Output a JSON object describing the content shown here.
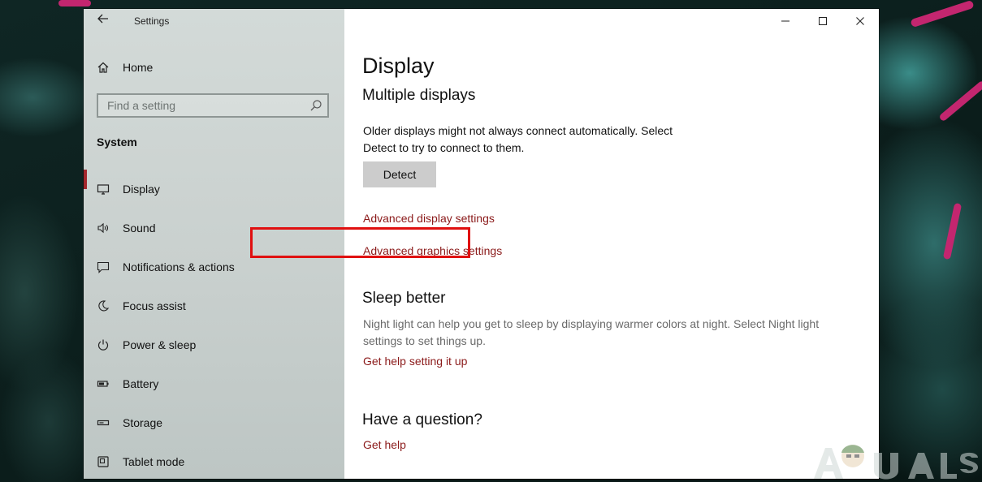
{
  "window": {
    "title": "Settings",
    "controls": [
      "minimize",
      "maximize",
      "close"
    ]
  },
  "sidebar": {
    "home_label": "Home",
    "search": {
      "placeholder": "Find a setting"
    },
    "section_label": "System",
    "items": [
      {
        "label": "Display",
        "icon": "monitor-icon",
        "selected": true
      },
      {
        "label": "Sound",
        "icon": "speaker-icon"
      },
      {
        "label": "Notifications & actions",
        "icon": "notification-icon"
      },
      {
        "label": "Focus assist",
        "icon": "moon-icon"
      },
      {
        "label": "Power & sleep",
        "icon": "power-icon"
      },
      {
        "label": "Battery",
        "icon": "battery-icon"
      },
      {
        "label": "Storage",
        "icon": "storage-icon"
      },
      {
        "label": "Tablet mode",
        "icon": "tablet-mode-icon"
      }
    ]
  },
  "content": {
    "page_title": "Display",
    "multiple_displays": {
      "heading": "Multiple displays",
      "description_line1": "Older displays might not always connect automatically. Select",
      "description_line2": "Detect to try to connect to them.",
      "detect_button": "Detect",
      "advanced_display_link": "Advanced display settings",
      "advanced_graphics_link": "Advanced graphics settings"
    },
    "sleep_better": {
      "heading": "Sleep better",
      "description_line1": "Night light can help you get to sleep by displaying warmer colors at night. Select Night light",
      "description_line2": "settings to set things up.",
      "help_link": "Get help setting it up"
    },
    "question": {
      "heading": "Have a question?",
      "help_link": "Get help"
    }
  },
  "annotation": {
    "color": "#e01010",
    "target": "advanced_graphics_link"
  },
  "colors": {
    "accent": "#a4262c",
    "link": "#8b1a1a",
    "sidebar_bg": "#ccd3d1",
    "button_bg": "#cccccc"
  }
}
